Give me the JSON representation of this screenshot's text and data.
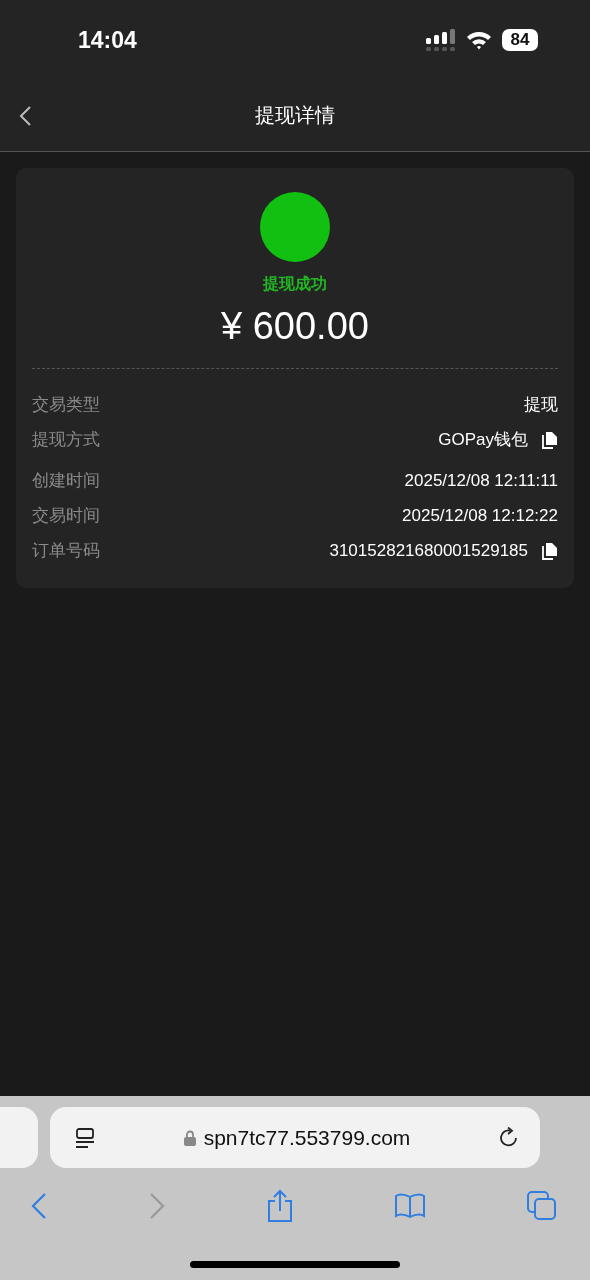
{
  "status_bar": {
    "time": "14:04",
    "battery": "84"
  },
  "nav": {
    "title": "提现详情"
  },
  "result": {
    "status": "提现成功",
    "amount": "¥ 600.00"
  },
  "rows": [
    {
      "label": "交易类型",
      "value": "提现",
      "copyable": false
    },
    {
      "label": "提现方式",
      "value": "GOPay钱包",
      "copyable": true
    },
    {
      "label": "创建时间",
      "value": "2025/12/08 12:11:11",
      "copyable": false
    },
    {
      "label": "交易时间",
      "value": "2025/12/08 12:12:22",
      "copyable": false
    },
    {
      "label": "订单号码",
      "value": "310152821680001529185",
      "copyable": true
    }
  ],
  "browser": {
    "url": "spn7tc77.553799.com"
  }
}
